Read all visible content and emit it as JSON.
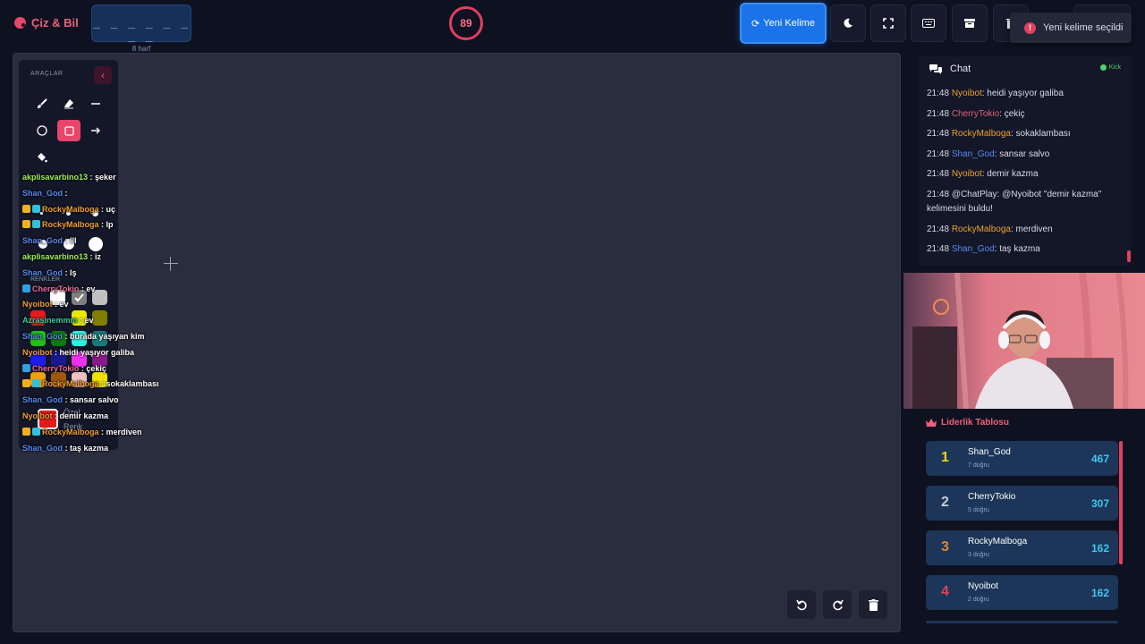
{
  "header": {
    "app_title": "Çiz & Bil",
    "word_hint": "_ _ _ _ _ _ _ _",
    "word_length": "8 harf",
    "timer": "89",
    "new_word_label": "Yeni Kelime",
    "toast": "Yeni kelime seçildi"
  },
  "tools": {
    "title": "ARAÇLAR",
    "colors_title": "RENKLER",
    "custom_color_label": "Özel Renk",
    "items": [
      "brush-icon",
      "eraser-icon",
      "line-icon",
      "circle-icon",
      "square-icon",
      "arrow-icon",
      "fill-icon"
    ],
    "swatches": [
      "#ffffff",
      "#7f7f7f",
      "#c0c0c0",
      "#e41b1b",
      "#e8e8e8",
      "#e8d800",
      "#808000",
      "#22c018",
      "#107a10",
      "#30f0e0",
      "#1a7a7a",
      "#1c1cf0",
      "#1a1a90",
      "#f030f0",
      "#8a1a8a",
      "#f0a000",
      "#a05a10",
      "#f0c0c0",
      "#f0e000"
    ]
  },
  "overlay_chat": [
    {
      "user": "akplisavarbino13",
      "user_color": "#a0f050",
      "text": " : şeker",
      "badges": []
    },
    {
      "user": "Shan_God",
      "user_color": "#5a8af0",
      "text": " : ",
      "badges": []
    },
    {
      "user": "RockyMalboga",
      "user_color": "#f0a030",
      "text": " : uç",
      "badges": [
        "#f0b020",
        "#30c0e0"
      ]
    },
    {
      "user": "RockyMalboga",
      "user_color": "#f0a030",
      "text": " : lp",
      "badges": [
        "#f0b020",
        "#30c0e0"
      ]
    },
    {
      "user": "Shan_God",
      "user_color": "#5a8af0",
      "text": " : lll",
      "badges": []
    },
    {
      "user": "akplisavarbino13",
      "user_color": "#a0f050",
      "text": " : iz",
      "badges": []
    },
    {
      "user": "Shan_God",
      "user_color": "#5a8af0",
      "text": " : lş",
      "badges": []
    },
    {
      "user": "CherryTokio",
      "user_color": "#f06a9a",
      "text": " : ev",
      "badges": [
        "#30a0e0"
      ]
    },
    {
      "user": "Nyoibot",
      "user_color": "#f0a030",
      "text": " : ev",
      "badges": []
    },
    {
      "user": "Azrasinemmm",
      "user_color": "#30d0a0",
      "text": " : ev",
      "badges": []
    },
    {
      "user": "Shan_God",
      "user_color": "#5a8af0",
      "text": " : burada yaşıyan kim",
      "badges": []
    },
    {
      "user": "Nyoibot",
      "user_color": "#f0a030",
      "text": " : heidi yaşıyor galiba",
      "badges": []
    },
    {
      "user": "CherryTokio",
      "user_color": "#f06a9a",
      "text": " : çekiç",
      "badges": [
        "#30a0e0"
      ]
    },
    {
      "user": "RockyMalboga",
      "user_color": "#f0a030",
      "text": " : sokaklambası",
      "badges": [
        "#f0b020",
        "#30c0e0"
      ]
    },
    {
      "user": "Shan_God",
      "user_color": "#5a8af0",
      "text": " : sansar salvo",
      "badges": []
    },
    {
      "user": "Nyoibot",
      "user_color": "#f0a030",
      "text": " : demir kazma",
      "badges": []
    },
    {
      "user": "RockyMalboga",
      "user_color": "#f0a030",
      "text": " : merdiven",
      "badges": [
        "#f0b020",
        "#30c0e0"
      ]
    },
    {
      "user": "Shan_God",
      "user_color": "#5a8af0",
      "text": " : taş kazma",
      "badges": []
    }
  ],
  "chat": {
    "title": "Chat",
    "platform": "Kick",
    "messages": [
      {
        "time": "21:48",
        "user": "Nyoibot",
        "user_color": "#f0a030",
        "text": ": heidi yaşıyor galiba"
      },
      {
        "time": "21:48",
        "user": "CherryTokio",
        "user_color": "#e0607a",
        "text": ": çekiç"
      },
      {
        "time": "21:48",
        "user": "RockyMalboga",
        "user_color": "#f0a030",
        "text": ": sokaklambası"
      },
      {
        "time": "21:48",
        "user": "Shan_God",
        "user_color": "#5a8af0",
        "text": ": sansar salvo"
      },
      {
        "time": "21:48",
        "user": "Nyoibot",
        "user_color": "#f0a030",
        "text": ": demir kazma"
      },
      {
        "time": "21:48",
        "user": "",
        "user_color": "#d8dbe6",
        "text": "@ChatPlay: @Nyoibot \"demir kazma\" kelimesini buldu!"
      },
      {
        "time": "21:48",
        "user": "RockyMalboga",
        "user_color": "#f0a030",
        "text": ": merdiven"
      },
      {
        "time": "21:48",
        "user": "Shan_God",
        "user_color": "#5a8af0",
        "text": ": taş kazma"
      }
    ]
  },
  "leaderboard": {
    "title": "Liderlik Tablosu",
    "rows": [
      {
        "rank": "1",
        "rank_color": "#f0d020",
        "name": "Shan_God",
        "sub": "7 doğru",
        "score": "467"
      },
      {
        "rank": "2",
        "rank_color": "#c8ccd8",
        "name": "CherryTokio",
        "sub": "5 doğru",
        "score": "307"
      },
      {
        "rank": "3",
        "rank_color": "#e0862a",
        "name": "RockyMalboga",
        "sub": "3 doğru",
        "score": "162"
      },
      {
        "rank": "4",
        "rank_color": "#e0405e",
        "name": "Nyoibot",
        "sub": "2 doğru",
        "score": "162"
      }
    ]
  }
}
